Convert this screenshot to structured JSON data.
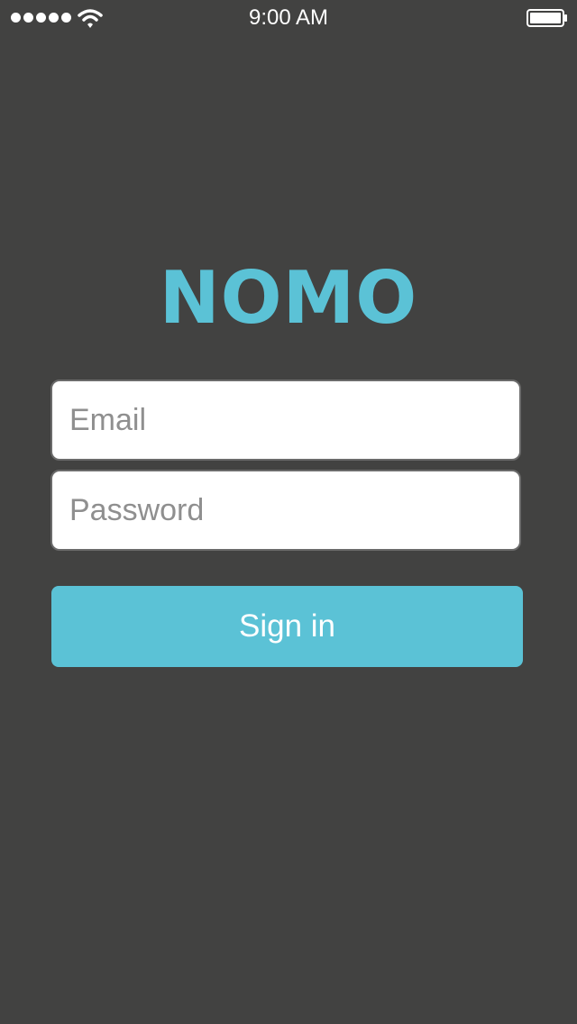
{
  "status_bar": {
    "time": "9:00 AM"
  },
  "brand": {
    "logo_text": "NOMO"
  },
  "login": {
    "email_placeholder": "Email",
    "password_placeholder": "Password",
    "sign_in_label": "Sign in"
  },
  "icons": {
    "signal": "signal-strength-icon",
    "wifi": "wifi-icon",
    "battery": "battery-icon"
  },
  "colors": {
    "background": "#424241",
    "accent": "#5bc2d6",
    "field_background": "#ffffff",
    "placeholder": "#8f8f8f"
  }
}
